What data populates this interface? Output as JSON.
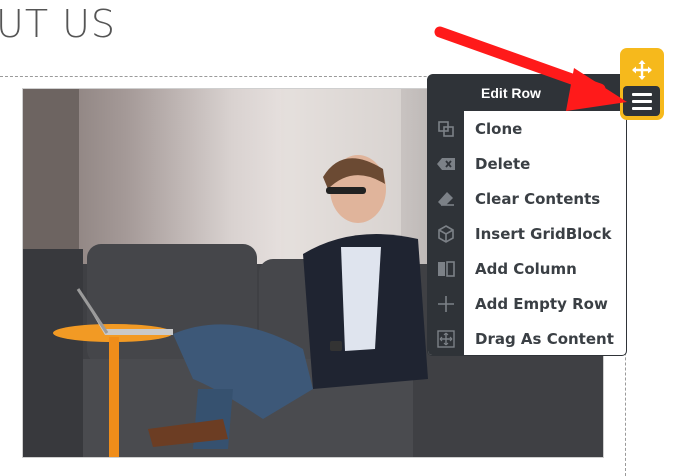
{
  "page": {
    "heading": "UT US"
  },
  "row_menu": {
    "title": "Edit Row",
    "items": [
      {
        "label": "Clone",
        "icon": "clone-icon"
      },
      {
        "label": "Delete",
        "icon": "delete-icon"
      },
      {
        "label": "Clear Contents",
        "icon": "eraser-icon"
      },
      {
        "label": "Insert GridBlock",
        "icon": "cube-icon"
      },
      {
        "label": "Add Column",
        "icon": "add-column-icon"
      },
      {
        "label": "Add Empty Row",
        "icon": "plus-icon"
      },
      {
        "label": "Drag As Content",
        "icon": "drag-icon"
      }
    ]
  },
  "row_handle": {
    "move_icon": "move-icon",
    "menu_icon": "hamburger-icon",
    "color": "#f6b91c"
  },
  "annotation": {
    "arrow_color": "#ff1a1a"
  },
  "colors": {
    "menu_dark": "#2f3338",
    "menu_text": "#3a3f44"
  }
}
